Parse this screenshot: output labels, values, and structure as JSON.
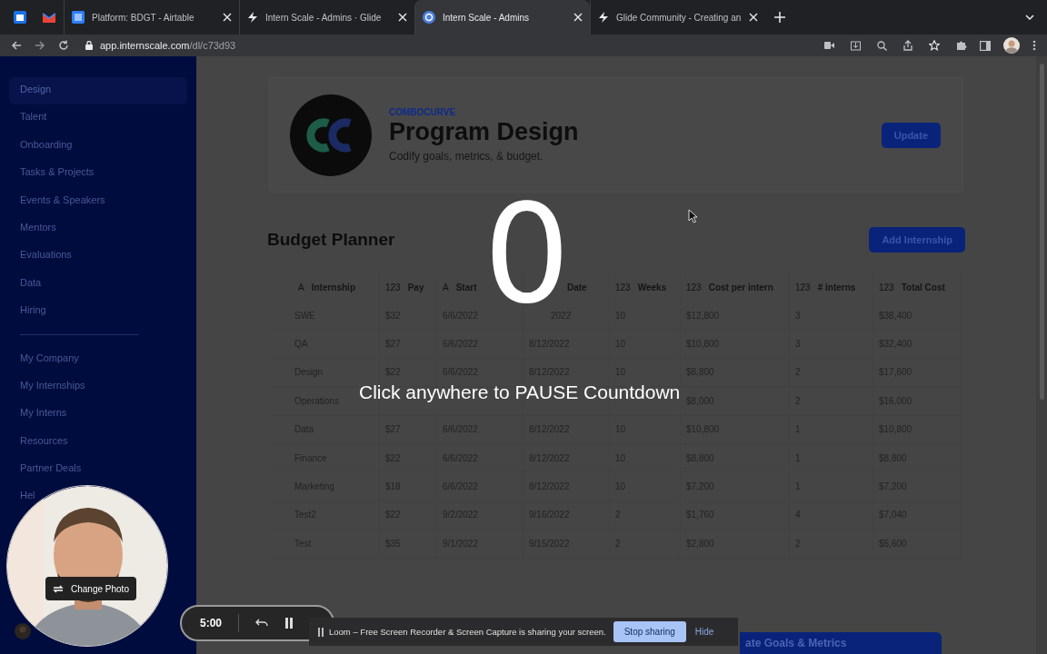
{
  "browser": {
    "tabs": [
      {
        "kind": "pinned",
        "selected": false
      },
      {
        "kind": "pinned",
        "selected": false
      },
      {
        "kind": "normal",
        "title": "Platform: BDGT - Airtable",
        "selected": false
      },
      {
        "kind": "normal",
        "title": "Intern Scale - Admins · Glide",
        "selected": false
      },
      {
        "kind": "normal",
        "title": "Intern Scale - Admins",
        "selected": true
      },
      {
        "kind": "normal",
        "title": "Glide Community - Creating an",
        "selected": false
      }
    ],
    "url_host": "app.internscale.com",
    "url_path": "/dl/c73d93"
  },
  "sidebar": {
    "groups": [
      {
        "items": [
          {
            "label": "Design",
            "selected": true
          },
          {
            "label": "Talent",
            "selected": false
          },
          {
            "label": "Onboarding",
            "selected": false
          },
          {
            "label": "Tasks & Projects",
            "selected": false
          },
          {
            "label": "Events & Speakers",
            "selected": false
          },
          {
            "label": "Mentors",
            "selected": false
          },
          {
            "label": "Evaluations",
            "selected": false
          },
          {
            "label": "Data",
            "selected": false
          },
          {
            "label": "Hiring",
            "selected": false
          }
        ]
      },
      {
        "items": [
          {
            "label": "My Company",
            "selected": false
          },
          {
            "label": "My Internships",
            "selected": false
          },
          {
            "label": "My Interns",
            "selected": false
          },
          {
            "label": "Resources",
            "selected": false
          },
          {
            "label": "Partner Deals",
            "selected": false
          },
          {
            "label": "Hel",
            "selected": false
          }
        ]
      }
    ]
  },
  "header": {
    "eyebrow": "COMBOCURVE",
    "title": "Program Design",
    "subtitle": "Codify goals, metrics, & budget.",
    "button": "Update"
  },
  "budget": {
    "title": "Budget Planner",
    "button": "Add Internship",
    "table": {
      "columns": [
        {
          "type": "A",
          "label": "Internship"
        },
        {
          "type": "123",
          "label": "Pay"
        },
        {
          "type": "A",
          "label": "Start"
        },
        {
          "label": "Date"
        },
        {
          "type": "123",
          "label": "Weeks"
        },
        {
          "type": "123",
          "label": "Cost per intern"
        },
        {
          "type": "123",
          "label": "# interns"
        },
        {
          "type": "123",
          "label": "Total Cost"
        }
      ],
      "rows": [
        [
          "SWE",
          "$32",
          "6/6/2022",
          "2022",
          "10",
          "$12,800",
          "3",
          "$38,400"
        ],
        [
          "QA",
          "$27",
          "6/6/2022",
          "8/12/2022",
          "10",
          "$10,800",
          "3",
          "$32,400"
        ],
        [
          "Design",
          "$22",
          "6/6/2022",
          "8/12/2022",
          "10",
          "$8,800",
          "2",
          "$17,600"
        ],
        [
          "Operations",
          null,
          null,
          null,
          null,
          "$8,000",
          "2",
          "$16,000"
        ],
        [
          "Data",
          "$27",
          "6/6/2022",
          "8/12/2022",
          "10",
          "$10,800",
          "1",
          "$10,800"
        ],
        [
          "Finance",
          "$22",
          "6/6/2022",
          "8/12/2022",
          "10",
          "$8,800",
          "1",
          "$8,800"
        ],
        [
          "Marketing",
          "$18",
          "6/6/2022",
          "8/12/2022",
          "10",
          "$7,200",
          "1",
          "$7,200"
        ],
        [
          "Test2",
          "$22",
          "9/2/2022",
          "9/16/2022",
          "2",
          "$1,760",
          "4",
          "$7,040"
        ],
        [
          "Test",
          "$35",
          "9/1/2022",
          "9/15/2022",
          "2",
          "$2,800",
          "2",
          "$5,600"
        ]
      ]
    }
  },
  "bottom_button": "ate Goals & Metrics",
  "countdown": {
    "number": "0",
    "message": "Click anywhere to PAUSE Countdown"
  },
  "webcam": {
    "button": "Change Photo"
  },
  "recorder": {
    "time": "5:00"
  },
  "share_bar": {
    "message": "Loom – Free Screen Recorder & Screen Capture is sharing your screen.",
    "stop": "Stop sharing",
    "hide": "Hide"
  }
}
